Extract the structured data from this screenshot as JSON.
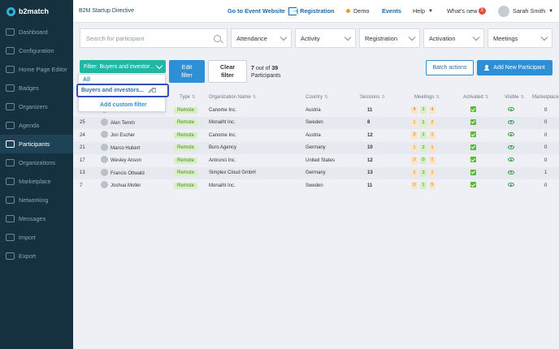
{
  "brand": {
    "name": "b2match"
  },
  "sidebar": {
    "items": [
      {
        "label": "Dashboard"
      },
      {
        "label": "Configuration"
      },
      {
        "label": "Home Page Editor"
      },
      {
        "label": "Badges"
      },
      {
        "label": "Organizers"
      },
      {
        "label": "Agenda"
      },
      {
        "label": "Participants",
        "active": true
      },
      {
        "label": "Organizations"
      },
      {
        "label": "Marketplace"
      },
      {
        "label": "Networking"
      },
      {
        "label": "Messages"
      },
      {
        "label": "Import"
      },
      {
        "label": "Export"
      }
    ]
  },
  "topbar": {
    "event_name": "B2M Startup Directive",
    "go_to_event": "Go to Event Website",
    "registration": "| Registration",
    "demo": "Demo",
    "events": "Events",
    "help": "Help",
    "whats_new": "What's new",
    "notification_count": "3",
    "user_name": "Sarah Smith"
  },
  "filters": {
    "search_placeholder": "Search for participant",
    "dropdowns": [
      "Attendance",
      "Activity",
      "Registration",
      "Activation",
      "Meetings"
    ]
  },
  "actions": {
    "filter_label": "Filter: Buyers and investor...",
    "edit_filter_line1": "Edit",
    "edit_filter_line2": "filter",
    "clear_filter_line1": "Clear",
    "clear_filter_line2": "filter",
    "count_shown": "7",
    "count_mid": " out of ",
    "count_total": "39",
    "count_suffix": "Participants",
    "batch_actions": "Batch actions",
    "add_new": "Add New Participant"
  },
  "filter_menu": {
    "all": "All",
    "selected": "Buyers and investors...",
    "add_custom": "Add custom filter"
  },
  "table": {
    "headers": {
      "type": "Type",
      "org": "Organization Name",
      "country": "Country",
      "sessions": "Sessions",
      "meetings": "Meetings",
      "activated": "Activated",
      "visible": "Visible",
      "marketplace": "Marketplace"
    },
    "rows": [
      {
        "id": "",
        "name": "",
        "type": "Remote",
        "org": "Canome Inc.",
        "country": "Austria",
        "sessions": "11",
        "m1": "4",
        "m2": "1",
        "m3": "4",
        "market": "0"
      },
      {
        "id": "25",
        "name": "Alen Temm",
        "type": "Remote",
        "org": "Monaiht Inc.",
        "country": "Sweden",
        "sessions": "8",
        "m1": "1",
        "m2": "1",
        "m3": "2",
        "market": "0"
      },
      {
        "id": "24",
        "name": "Jon Escher",
        "type": "Remote",
        "org": "Canome Inc.",
        "country": "Austria",
        "sessions": "12",
        "m1": "3",
        "m2": "1",
        "m3": "1",
        "market": "0"
      },
      {
        "id": "21",
        "name": "Marco Hubert",
        "type": "Remote",
        "org": "Buro Agency",
        "country": "Germany",
        "sessions": "10",
        "m1": "1",
        "m2": "2",
        "m3": "1",
        "market": "0"
      },
      {
        "id": "17",
        "name": "Wesley Anson",
        "type": "Remote",
        "org": "Antrunci Inc.",
        "country": "United States",
        "sessions": "12",
        "m1": "3",
        "m2": "0",
        "m3": "1",
        "market": "0"
      },
      {
        "id": "13",
        "name": "Francis Ottwald",
        "type": "Remote",
        "org": "Simplex Cloud GmbH",
        "country": "Germany",
        "sessions": "13",
        "m1": "2",
        "m2": "3",
        "m3": "1",
        "market": "1"
      },
      {
        "id": "7",
        "name": "Joshua Moller",
        "type": "Remote",
        "org": "Monaiht Inc.",
        "country": "Sweden",
        "sessions": "11",
        "m1": "0",
        "m2": "1",
        "m3": "5",
        "market": "0"
      }
    ]
  }
}
